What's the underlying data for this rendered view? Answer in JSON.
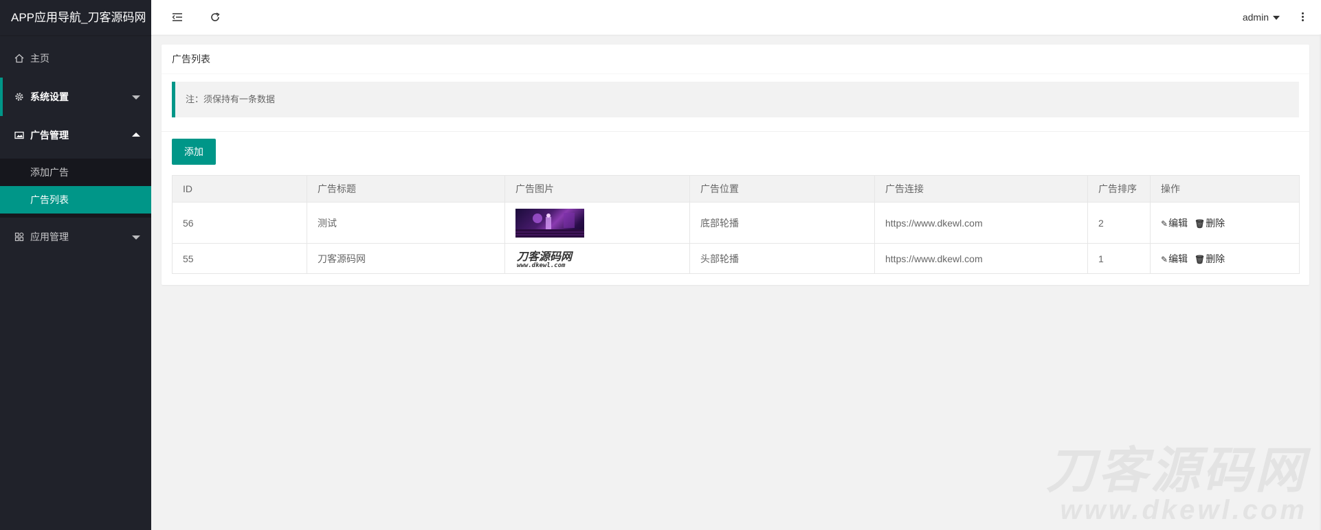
{
  "app": {
    "title": "APP应用导航_刀客源码网"
  },
  "sidebar": {
    "home": "主页",
    "system": "系统设置",
    "ads": "广告管理",
    "ads_children": [
      "添加广告",
      "广告列表"
    ],
    "apps": "应用管理"
  },
  "header": {
    "user": "admin"
  },
  "card": {
    "title": "广告列表",
    "note": "注：须保持有一条数据",
    "add_label": "添加"
  },
  "table": {
    "columns": [
      "ID",
      "广告标题",
      "广告图片",
      "广告位置",
      "广告连接",
      "广告排序",
      "操作"
    ],
    "rows": [
      {
        "id": "56",
        "title": "测试",
        "image": "photo-thumbnail",
        "position": "底部轮播",
        "link": "https://www.dkewl.com",
        "sort": "2"
      },
      {
        "id": "55",
        "title": "刀客源码网",
        "image": "logo-thumbnail",
        "position": "头部轮播",
        "link": "https://www.dkewl.com",
        "sort": "1"
      }
    ],
    "edit_label": "编辑",
    "delete_label": "删除"
  },
  "thumbnail_logo": {
    "line1": "刀客源码网",
    "line2": "www.dkewl.com"
  },
  "watermark": {
    "line1": "刀客源码网",
    "line2": "www.dkewl.com"
  },
  "colors": {
    "accent": "#009688",
    "sidebar": "#20222a"
  }
}
